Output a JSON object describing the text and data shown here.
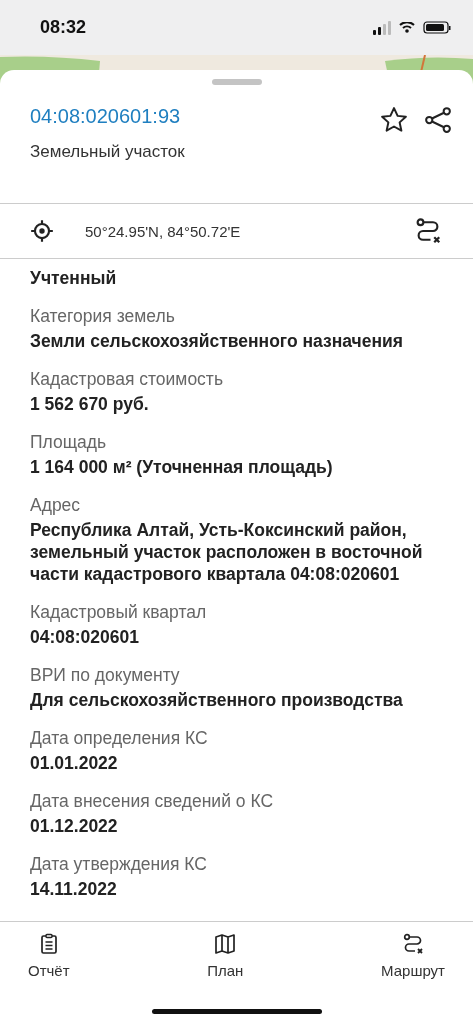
{
  "status_bar": {
    "time": "08:32"
  },
  "sheet": {
    "title": "04:08:020601:93",
    "subtitle": "Земельный участок",
    "coordinates": "50°24.95'N, 84°50.72'E"
  },
  "fields": [
    {
      "value": "Учтенный"
    },
    {
      "label": "Категория земель",
      "value": "Земли сельскохозяйственного назначения"
    },
    {
      "label": "Кадастровая стоимость",
      "value": "1 562 670 руб."
    },
    {
      "label": "Площадь",
      "value": "1 164 000 м² (Уточненная площадь)"
    },
    {
      "label": "Адрес",
      "value": "Республика Алтай, Усть-Коксинский район, земельный участок расположен в восточной части кадастрового квартала 04:08:020601"
    },
    {
      "label": "Кадастровый квартал",
      "value": "04:08:020601"
    },
    {
      "label": "ВРИ по документу",
      "value": "Для сельскохозяйственного производства"
    },
    {
      "label": "Дата определения КС",
      "value": "01.01.2022"
    },
    {
      "label": "Дата внесения сведений о КС",
      "value": "01.12.2022"
    },
    {
      "label": "Дата утверждения КС",
      "value": "14.11.2022"
    }
  ],
  "tabs": [
    {
      "kind": "report",
      "label": "Отчёт"
    },
    {
      "kind": "plan",
      "label": "План"
    },
    {
      "kind": "route",
      "label": "Маршрут"
    }
  ]
}
